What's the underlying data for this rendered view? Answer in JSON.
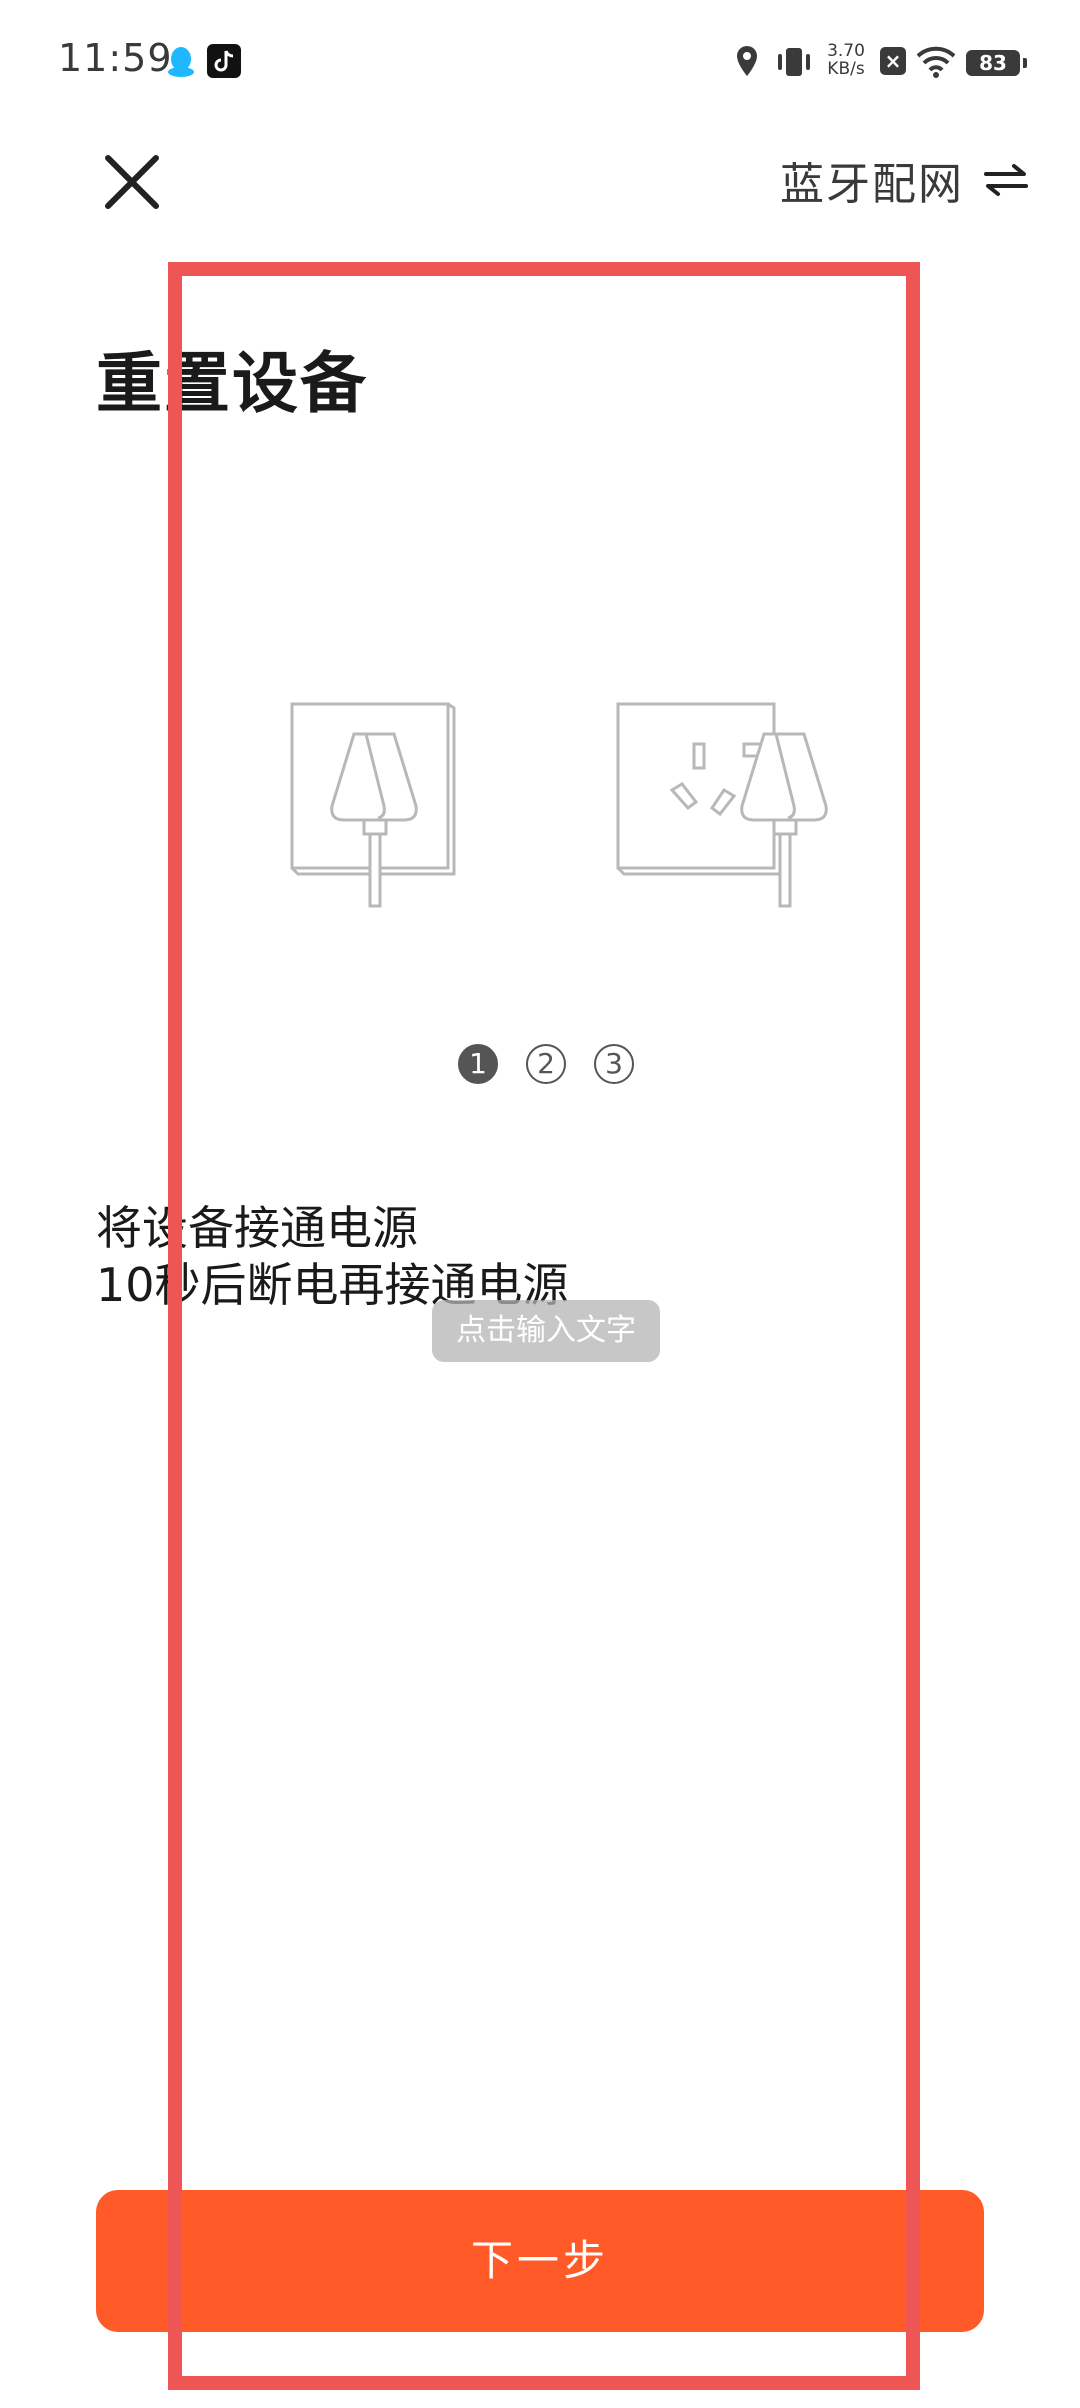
{
  "status_bar": {
    "time": "11:59",
    "net_speed_value": "3.70",
    "net_speed_unit": "KB/s",
    "battery": "83",
    "icons": [
      "qq-icon",
      "tiktok-icon",
      "location-icon",
      "vibrate-icon",
      "sim-x-icon",
      "wifi-icon",
      "battery-icon"
    ]
  },
  "header": {
    "close_icon": "close-icon",
    "bt_pair_label": "蓝牙配网",
    "swap_icon": "swap-icon"
  },
  "page": {
    "title": "重置设备",
    "illustrations": [
      "plug-in-outlet-icon",
      "unplug-outlet-icon"
    ],
    "steps": [
      "1",
      "2",
      "3"
    ],
    "active_step": 1,
    "instruction_line1": "将设备接通电源",
    "instruction_line2": "10秒后断电再接通电源"
  },
  "overlay": {
    "text_hint": "点击输入文字"
  },
  "footer": {
    "next_label": "下一步"
  },
  "colors": {
    "accent": "#ff5a28",
    "highlight": "#ee5555",
    "step_active": "#555555"
  }
}
